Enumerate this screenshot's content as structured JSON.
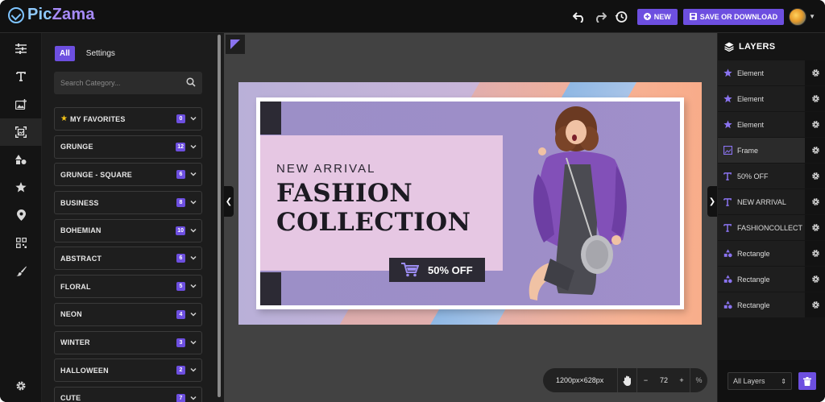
{
  "app": {
    "name_part1": "Pic",
    "name_part2": "Zama"
  },
  "topbar": {
    "new_label": "NEW",
    "save_label": "SAVE OR DOWNLOAD"
  },
  "tabs": {
    "all": "All",
    "settings": "Settings"
  },
  "search": {
    "placeholder": "Search Category..."
  },
  "categories": [
    {
      "label": "MY FAVORITES",
      "count": "0",
      "favorite": true
    },
    {
      "label": "GRUNGE",
      "count": "12"
    },
    {
      "label": "GRUNGE - SQUARE",
      "count": "6"
    },
    {
      "label": "BUSINESS",
      "count": "8"
    },
    {
      "label": "BOHEMIAN",
      "count": "10"
    },
    {
      "label": "ABSTRACT",
      "count": "6"
    },
    {
      "label": "FLORAL",
      "count": "5"
    },
    {
      "label": "NEON",
      "count": "4"
    },
    {
      "label": "WINTER",
      "count": "3"
    },
    {
      "label": "HALLOWEEN",
      "count": "2"
    },
    {
      "label": "CUTE",
      "count": "7"
    }
  ],
  "design": {
    "subtitle": "NEW ARRIVAL",
    "title_line1": "FASHION",
    "title_line2": "COLLECTION",
    "offer": "50% OFF"
  },
  "zoom": {
    "size": "1200px×628px",
    "value": "72",
    "minus": "−",
    "plus": "+",
    "percent": "%"
  },
  "layers": {
    "title": "LAYERS",
    "items": [
      {
        "label": "Element",
        "icon": "star-icon"
      },
      {
        "label": "Element",
        "icon": "star-icon"
      },
      {
        "label": "Element",
        "icon": "star-icon"
      },
      {
        "label": "Frame",
        "icon": "frame-icon"
      },
      {
        "label": "50% OFF",
        "icon": "text-icon"
      },
      {
        "label": "NEW ARRIVAL",
        "icon": "text-icon"
      },
      {
        "label": "FASHIONCOLLECT",
        "icon": "text-icon"
      },
      {
        "label": "Rectangle",
        "icon": "shapes-icon"
      },
      {
        "label": "Rectangle",
        "icon": "shapes-icon"
      },
      {
        "label": "Rectangle",
        "icon": "shapes-icon"
      }
    ],
    "filter": "All Layers"
  },
  "colors": {
    "accent": "#6d4fe0",
    "background": "#151515"
  }
}
